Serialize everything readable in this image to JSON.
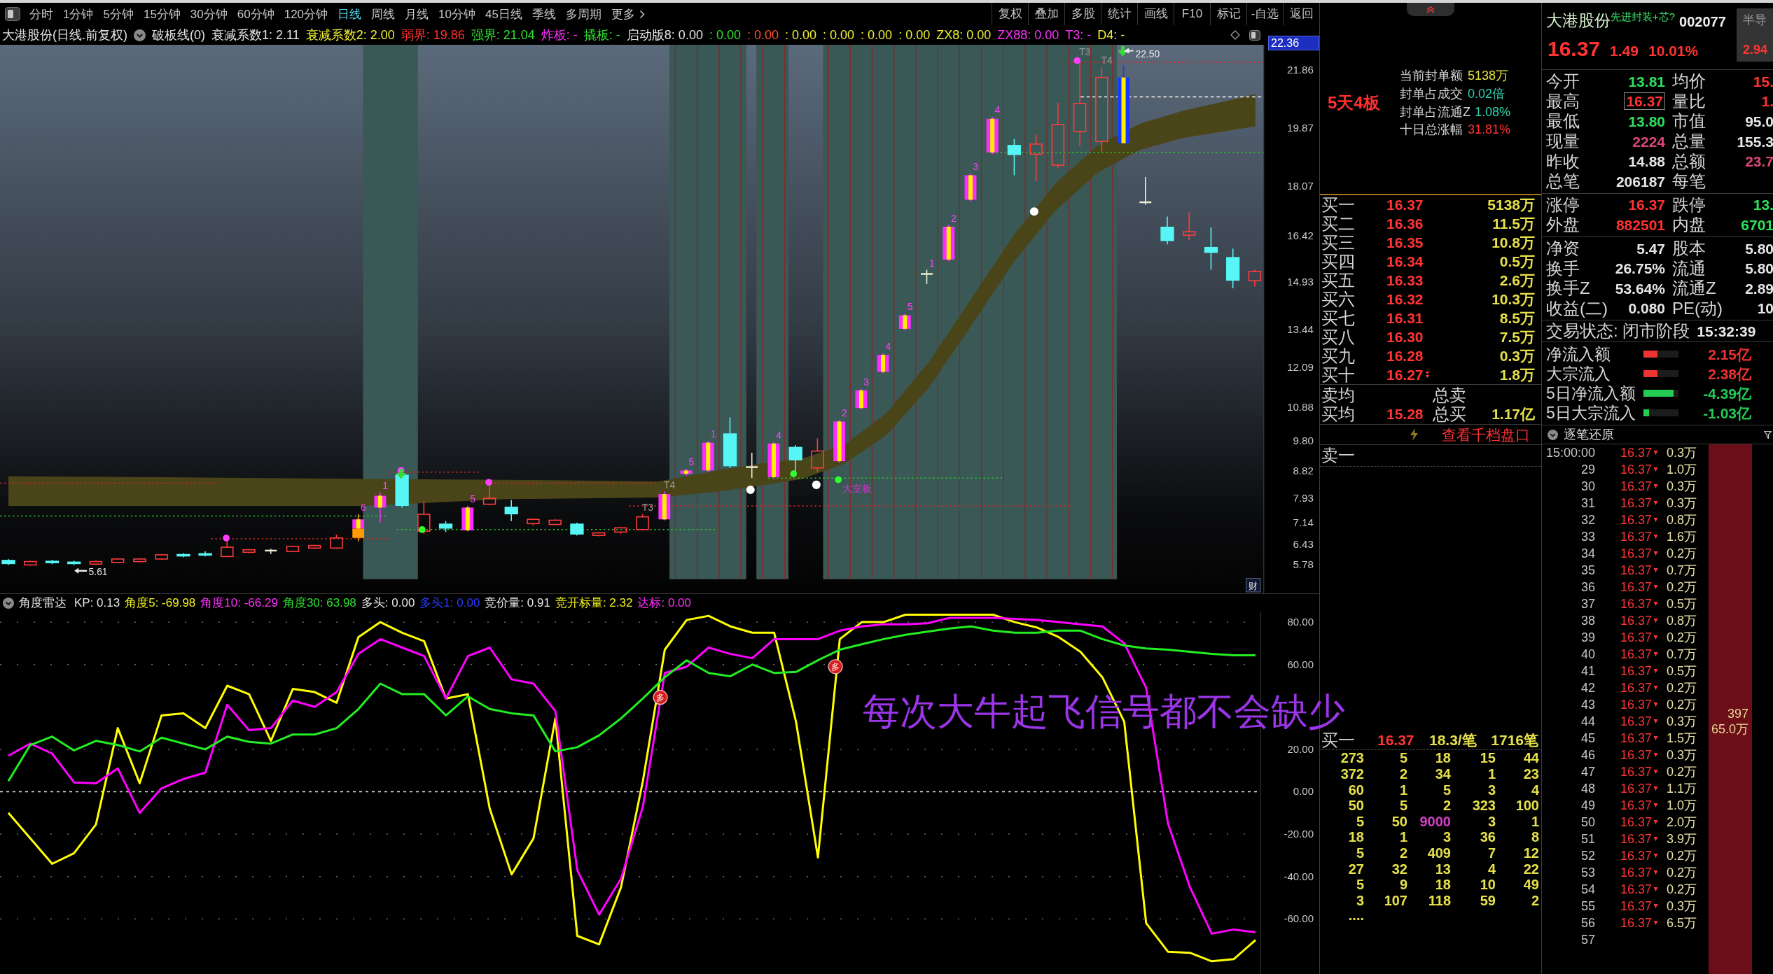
{
  "toolbar": {
    "periods": [
      {
        "label": "分时",
        "selected": false,
        "kind": "tab"
      },
      {
        "label": "1分钟",
        "selected": false,
        "kind": "tab"
      },
      {
        "label": "5分钟",
        "selected": false,
        "kind": "tab"
      },
      {
        "label": "15分钟",
        "selected": false,
        "kind": "tab"
      },
      {
        "label": "30分钟",
        "selected": false,
        "kind": "tab"
      },
      {
        "label": "60分钟",
        "selected": false,
        "kind": "tab"
      },
      {
        "label": "120分钟",
        "selected": false,
        "kind": "tab"
      },
      {
        "label": "日线",
        "selected": true,
        "kind": "tab"
      },
      {
        "label": "周线",
        "selected": false,
        "kind": "tab"
      },
      {
        "label": "月线",
        "selected": false,
        "kind": "tab"
      },
      {
        "label": "10分钟",
        "selected": false,
        "kind": "tab"
      },
      {
        "label": "45日线",
        "selected": false,
        "kind": "tab"
      },
      {
        "label": "季线",
        "selected": false,
        "kind": "tab"
      },
      {
        "label": "多周期",
        "selected": false,
        "kind": "tab"
      },
      {
        "label": "更多",
        "selected": false,
        "kind": "menu"
      }
    ],
    "actions": [
      "复权",
      "叠加",
      "多股",
      "统计",
      "画线",
      "F10",
      "标记",
      "-自选",
      "返回"
    ]
  },
  "chart_header": {
    "title": "大港股份(日线.前复权)",
    "indicator": "破板线(0)",
    "values": [
      {
        "text": "衰减系数1: 2.11",
        "color": "#e6e6e6"
      },
      {
        "text": "衰减系数2: 2.00",
        "color": "#f0f030"
      },
      {
        "text": "弱界: 19.86",
        "color": "#ff3030"
      },
      {
        "text": "强界: 21.04",
        "color": "#30e030"
      },
      {
        "text": "炸板: -",
        "color": "#ff30ff"
      },
      {
        "text": "撬板: -",
        "color": "#30e030"
      },
      {
        "text": "启动版8: 0.00",
        "color": "#e6e6e6"
      },
      {
        "text": ": 0.00",
        "color": "#30e030"
      },
      {
        "text": ": 0.00",
        "color": "#ff5030"
      },
      {
        "text": ": 0.00",
        "color": "#f0f030"
      },
      {
        "text": ": 0.00",
        "color": "#f0f030"
      },
      {
        "text": ": 0.00",
        "color": "#f0f030"
      },
      {
        "text": ": 0.00",
        "color": "#f0f030"
      },
      {
        "text": "ZX8: 0.00",
        "color": "#f0f030"
      },
      {
        "text": "ZX88: 0.00",
        "color": "#ff30ff"
      },
      {
        "text": "T3: -",
        "color": "#ff30ff"
      },
      {
        "text": "D4: -",
        "color": "#f0f030"
      }
    ]
  },
  "price_chart": {
    "current_price": "22.36",
    "axis_labels": [
      "21.86",
      "19.87",
      "18.07",
      "16.42",
      "14.93",
      "13.44",
      "12.09",
      "10.88",
      "9.80",
      "8.82",
      "7.93",
      "7.14",
      "6.43",
      "5.78"
    ],
    "marks": [
      {
        "label": "6",
        "color": "#ff40ff"
      },
      {
        "label": "1",
        "color": "#ff40ff"
      },
      {
        "label": "5",
        "color": "#ff40ff"
      },
      {
        "label": "T3",
        "color": "#9a9a9a"
      },
      {
        "label": "T4",
        "color": "#9a9a9a"
      },
      {
        "label": "5",
        "color": "#ff40ff"
      },
      {
        "label": "1",
        "color": "#ff40ff"
      },
      {
        "label": "4",
        "color": "#ff40ff"
      },
      {
        "label": "2",
        "color": "#ff40ff"
      },
      {
        "label": "3",
        "color": "#ff40ff"
      },
      {
        "label": "4",
        "color": "#ff40ff"
      },
      {
        "label": "5",
        "color": "#ff40ff"
      },
      {
        "label": "1",
        "color": "#ff40ff"
      },
      {
        "label": "2",
        "color": "#ff40ff"
      },
      {
        "label": "3",
        "color": "#ff40ff"
      },
      {
        "label": "4",
        "color": "#ff40ff"
      },
      {
        "label": "T3",
        "color": "#9a9a9a"
      },
      {
        "label": "T4",
        "color": "#9a9a9a"
      }
    ],
    "note": "大室板",
    "high_label": "22.50",
    "low_label": "5.61",
    "corner_tag": "财"
  },
  "indicator_panel": {
    "title": "角度雷达",
    "values": [
      {
        "text": "KP: 0.13",
        "color": "#e6e6e6"
      },
      {
        "text": "角度5: -69.98",
        "color": "#f0f020"
      },
      {
        "text": "角度10: -66.29",
        "color": "#ff30ff"
      },
      {
        "text": "角度30: 63.98",
        "color": "#30e030"
      },
      {
        "text": "多头: 0.00",
        "color": "#e6e6e6"
      },
      {
        "text": "多头1: 0.00",
        "color": "#2a3cff"
      },
      {
        "text": "竞价量: 0.91",
        "color": "#e6e6e6"
      },
      {
        "text": "竞开标量: 2.32",
        "color": "#f0f020"
      },
      {
        "text": "达标: 0.00",
        "color": "#ff30ff"
      }
    ],
    "chart_data": {
      "type": "line",
      "categories": [
        null,
        null,
        null,
        null,
        null,
        null,
        null,
        null,
        null,
        null,
        null,
        null,
        null,
        null,
        null,
        null,
        null,
        null,
        null,
        null,
        null,
        null,
        null,
        null,
        null,
        null,
        null,
        null,
        null,
        null,
        null,
        null,
        null,
        null,
        null,
        null,
        null,
        null,
        null,
        null,
        null,
        null,
        null,
        null,
        null,
        null,
        null,
        null,
        null,
        null,
        null,
        null,
        null,
        null,
        null,
        null,
        null,
        null
      ],
      "ylim": [
        -86,
        85
      ],
      "yticks": [
        {
          "value": 80,
          "label": "80.00"
        },
        {
          "value": 60,
          "label": "60.00"
        },
        {
          "value": 20,
          "label": "20.00"
        },
        {
          "value": 0,
          "label": "0.00"
        },
        {
          "value": -20,
          "label": "-20.00"
        },
        {
          "value": -40,
          "label": "-40.00"
        },
        {
          "value": -60,
          "label": "-60.00"
        }
      ],
      "grid": true,
      "ref_lines": [
        {
          "axis": "y",
          "value": 0,
          "color": "#e8e8e8"
        }
      ],
      "series": [
        {
          "color": "#ffff00",
          "values": [
            -10,
            -22,
            -34,
            -29,
            -15.5,
            30,
            4,
            36,
            37,
            30,
            50,
            46,
            24,
            48.5,
            47,
            42,
            73,
            80,
            75,
            71,
            44,
            46,
            -8,
            -39,
            -22,
            34.6,
            -68,
            -72,
            -45,
            5,
            67,
            81,
            83,
            78,
            75,
            75,
            33,
            -31,
            72,
            80,
            80,
            83.5,
            83.5,
            83.5,
            83.5,
            83.5,
            80,
            77.5,
            73,
            66,
            54,
            33,
            -62,
            -75.5,
            -76,
            -80,
            -79,
            -70
          ]
        },
        {
          "color": "#ff00ff",
          "values": [
            17,
            22.7,
            18,
            4.4,
            4,
            11,
            -10,
            1.6,
            6,
            9,
            41,
            29,
            30,
            43,
            40,
            47,
            65,
            72,
            68,
            64,
            44,
            64,
            68,
            53,
            51,
            38,
            -37,
            -58,
            -41,
            -7,
            56,
            59,
            68,
            65,
            63,
            72,
            72,
            72,
            76,
            78,
            79,
            79,
            79.5,
            82,
            82,
            82,
            81.5,
            81,
            80,
            79,
            78,
            70,
            49,
            -15,
            -45,
            -67,
            -65,
            -66.3
          ]
        },
        {
          "color": "#22ee22",
          "values": [
            5,
            22,
            26,
            19.5,
            24,
            22,
            19,
            25.5,
            22.7,
            20,
            26,
            23.5,
            22.7,
            27,
            27,
            30,
            39,
            51,
            46,
            46,
            36,
            45,
            39,
            37,
            36,
            19,
            21,
            26.6,
            34.6,
            44,
            54,
            62,
            56,
            54.5,
            60,
            56,
            56.5,
            62,
            67,
            69.6,
            72,
            74,
            75.5,
            77,
            78,
            76,
            75,
            75,
            76,
            76,
            72,
            69,
            67.6,
            67,
            66,
            65,
            64.4,
            64.4
          ]
        }
      ]
    },
    "signals": [
      {
        "label": "多"
      },
      {
        "label": "多"
      }
    ],
    "overlay_text": "每次大牛起飞信号都不会缺少"
  },
  "order_book": {
    "limit_summary": {
      "streak": "5天4板",
      "rows": [
        {
          "label": "当前封单额",
          "value": "5138万",
          "color": "#e6e040"
        },
        {
          "label": "封单占成交",
          "value": "0.02倍",
          "color": "#2ed2b0"
        },
        {
          "label": "封单占流通Z",
          "value": "1.08%",
          "color": "#2ed2b0"
        },
        {
          "label": "十日总涨幅",
          "value": "31.81%",
          "color": "#ff3333"
        }
      ]
    },
    "bids": [
      {
        "label": "买一",
        "price": "16.37",
        "volume": "5138万",
        "flag": false
      },
      {
        "label": "买二",
        "price": "16.36",
        "volume": "11.5万",
        "flag": false
      },
      {
        "label": "买三",
        "price": "16.35",
        "volume": "10.8万",
        "flag": false
      },
      {
        "label": "买四",
        "price": "16.34",
        "volume": "0.5万",
        "flag": false
      },
      {
        "label": "买五",
        "price": "16.33",
        "volume": "2.6万",
        "flag": false
      },
      {
        "label": "买六",
        "price": "16.32",
        "volume": "10.3万",
        "flag": false
      },
      {
        "label": "买七",
        "price": "16.31",
        "volume": "8.5万",
        "flag": false
      },
      {
        "label": "买八",
        "price": "16.30",
        "volume": "7.5万",
        "flag": false
      },
      {
        "label": "买九",
        "price": "16.28",
        "volume": "0.3万",
        "flag": false
      },
      {
        "label": "买十",
        "price": "16.27",
        "volume": "1.8万",
        "flag": true
      }
    ],
    "averages": [
      {
        "label": "卖均",
        "total_label": "总卖"
      },
      {
        "label": "买均",
        "price": "15.28",
        "total_label": "总买",
        "total": "1.17亿"
      }
    ],
    "depth_link": "查看千档盘口",
    "ask_queue": {
      "label": "卖一"
    },
    "bid_queue": {
      "label": "买一",
      "price": "16.37",
      "per_order": "18.3/笔",
      "orders": "1716笔",
      "rows": [
        {
          "cells": [
            {
              "text": "273",
              "large": false
            },
            {
              "text": "5",
              "large": false
            },
            {
              "text": "18",
              "large": false
            },
            {
              "text": "15",
              "large": false
            },
            {
              "text": "44",
              "large": false
            }
          ]
        },
        {
          "cells": [
            {
              "text": "372",
              "large": false
            },
            {
              "text": "2",
              "large": false
            },
            {
              "text": "34",
              "large": false
            },
            {
              "text": "1",
              "large": false
            },
            {
              "text": "23",
              "large": false
            }
          ]
        },
        {
          "cells": [
            {
              "text": "60",
              "large": false
            },
            {
              "text": "1",
              "large": false
            },
            {
              "text": "5",
              "large": false
            },
            {
              "text": "3",
              "large": false
            },
            {
              "text": "4",
              "large": false
            }
          ]
        },
        {
          "cells": [
            {
              "text": "50",
              "large": false
            },
            {
              "text": "5",
              "large": false
            },
            {
              "text": "2",
              "large": false
            },
            {
              "text": "323",
              "large": false
            },
            {
              "text": "100",
              "large": false
            }
          ]
        },
        {
          "cells": [
            {
              "text": "5",
              "large": false
            },
            {
              "text": "50",
              "large": false
            },
            {
              "text": "9000",
              "large": true
            },
            {
              "text": "3",
              "large": false
            },
            {
              "text": "1",
              "large": false
            }
          ]
        },
        {
          "cells": [
            {
              "text": "18",
              "large": false
            },
            {
              "text": "1",
              "large": false
            },
            {
              "text": "3",
              "large": false
            },
            {
              "text": "36",
              "large": false
            },
            {
              "text": "8",
              "large": false
            }
          ]
        },
        {
          "cells": [
            {
              "text": "5",
              "large": false
            },
            {
              "text": "2",
              "large": false
            },
            {
              "text": "409",
              "large": false
            },
            {
              "text": "7",
              "large": false
            },
            {
              "text": "12",
              "large": false
            }
          ]
        },
        {
          "cells": [
            {
              "text": "27",
              "large": false
            },
            {
              "text": "32",
              "large": false
            },
            {
              "text": "13",
              "large": false
            },
            {
              "text": "4",
              "large": false
            },
            {
              "text": "22",
              "large": false
            }
          ]
        },
        {
          "cells": [
            {
              "text": "5",
              "large": false
            },
            {
              "text": "9",
              "large": false
            },
            {
              "text": "18",
              "large": false
            },
            {
              "text": "10",
              "large": false
            },
            {
              "text": "49",
              "large": false
            }
          ]
        },
        {
          "cells": [
            {
              "text": "3",
              "large": false
            },
            {
              "text": "107",
              "large": false
            },
            {
              "text": "118",
              "large": false
            },
            {
              "text": "59",
              "large": false
            },
            {
              "text": "2",
              "large": false
            }
          ]
        }
      ],
      "more": "...."
    }
  },
  "quote": {
    "name": "大港股份",
    "concept": "先进封装+芯?",
    "code": "002077",
    "sector": "半导",
    "sector_change": "2.94",
    "price": "16.37",
    "change": "1.49",
    "change_pct": "10.01%",
    "stat_groups": [
      [
        {
          "cells": [
            {
              "label": "今开",
              "value": "13.81",
              "color": "#2ee05e",
              "highlighted": false
            },
            {
              "label": "均价",
              "value": "15.",
              "color": "#ff3333",
              "highlighted": false
            }
          ]
        },
        {
          "cells": [
            {
              "label": "最高",
              "value": "16.37",
              "color": "#ff3333",
              "highlighted": true
            },
            {
              "label": "量比",
              "value": "1.",
              "color": "#ff3333",
              "highlighted": false
            }
          ]
        },
        {
          "cells": [
            {
              "label": "最低",
              "value": "13.80",
              "color": "#2ee05e",
              "highlighted": false
            },
            {
              "label": "市值",
              "value": "95.0",
              "color": "#e6e6e6",
              "highlighted": false
            }
          ]
        },
        {
          "cells": [
            {
              "label": "现量",
              "value": "2224",
              "color": "#d84874",
              "highlighted": false
            },
            {
              "label": "总量",
              "value": "155.3",
              "color": "#e6e6e6",
              "highlighted": false
            }
          ]
        },
        {
          "cells": [
            {
              "label": "昨收",
              "value": "14.88",
              "color": "#e6e6e6",
              "highlighted": false
            },
            {
              "label": "总额",
              "value": "23.7",
              "color": "#d84874",
              "highlighted": false
            }
          ]
        },
        {
          "cells": [
            {
              "label": "总笔",
              "value": "206187",
              "color": "#e6e6e6",
              "highlighted": false
            },
            {
              "label": "每笔"
            }
          ]
        }
      ],
      [
        {
          "cells": [
            {
              "label": "涨停",
              "value": "16.37",
              "color": "#ff3333",
              "highlighted": false
            },
            {
              "label": "跌停",
              "value": "13.",
              "color": "#2ee05e",
              "highlighted": false
            }
          ]
        },
        {
          "cells": [
            {
              "label": "外盘",
              "value": "882501",
              "color": "#ff3333",
              "highlighted": false
            },
            {
              "label": "内盘",
              "value": "6701",
              "color": "#2ee05e",
              "highlighted": false
            }
          ]
        }
      ],
      [
        {
          "cells": [
            {
              "label": "净资",
              "value": "5.47",
              "color": "#e6e6e6",
              "highlighted": false
            },
            {
              "label": "股本",
              "value": "5.80",
              "color": "#e6e6e6",
              "highlighted": false
            }
          ]
        },
        {
          "cells": [
            {
              "label": "换手",
              "value": "26.75%",
              "color": "#e6e6e6",
              "highlighted": false
            },
            {
              "label": "流通",
              "value": "5.80",
              "color": "#e6e6e6",
              "highlighted": false
            }
          ]
        },
        {
          "cells": [
            {
              "label": "换手Z",
              "value": "53.64%",
              "color": "#e6e6e6",
              "highlighted": false
            },
            {
              "label": "流通Z",
              "value": "2.89",
              "color": "#e6e6e6",
              "highlighted": false
            }
          ]
        },
        {
          "cells": [
            {
              "label": "收益(二)",
              "value": "0.080",
              "color": "#e6e6e6",
              "highlighted": false
            },
            {
              "label": "PE(动)",
              "value": "10",
              "color": "#e6e6e6",
              "highlighted": false
            }
          ]
        }
      ]
    ],
    "status": {
      "text": "交易状态: 闭市阶段",
      "time": "15:32:39"
    },
    "flows": [
      {
        "label": "净流入额",
        "level": 0.4,
        "color": "#ee3333",
        "value": "2.15亿"
      },
      {
        "label": "大宗流入",
        "level": 0.4,
        "color": "#ee3333",
        "value": "2.38亿"
      },
      {
        "label": "5日净流入额",
        "level": 0.86,
        "color": "#22cc55",
        "value": "-4.39亿"
      },
      {
        "label": "5日大宗流入",
        "level": 0.16,
        "color": "#22cc55",
        "value": "-1.03亿"
      }
    ]
  },
  "tick_list": {
    "title": "逐笔还原",
    "rows": [
      {
        "time": "15:00:00",
        "price": "16.37",
        "volume": "0.3万"
      },
      {
        "time": "29",
        "price": "16.37",
        "volume": "1.0万"
      },
      {
        "time": "30",
        "price": "16.37",
        "volume": "0.3万"
      },
      {
        "time": "31",
        "price": "16.37",
        "volume": "0.3万"
      },
      {
        "time": "32",
        "price": "16.37",
        "volume": "0.8万"
      },
      {
        "time": "33",
        "price": "16.37",
        "volume": "1.6万"
      },
      {
        "time": "34",
        "price": "16.37",
        "volume": "0.2万"
      },
      {
        "time": "35",
        "price": "16.37",
        "volume": "0.7万"
      },
      {
        "time": "36",
        "price": "16.37",
        "volume": "0.2万"
      },
      {
        "time": "37",
        "price": "16.37",
        "volume": "0.5万"
      },
      {
        "time": "38",
        "price": "16.37",
        "volume": "0.8万"
      },
      {
        "time": "39",
        "price": "16.37",
        "volume": "0.2万"
      },
      {
        "time": "40",
        "price": "16.37",
        "volume": "0.7万"
      },
      {
        "time": "41",
        "price": "16.37",
        "volume": "0.5万"
      },
      {
        "time": "42",
        "price": "16.37",
        "volume": "0.2万"
      },
      {
        "time": "43",
        "price": "16.37",
        "volume": "0.2万"
      },
      {
        "time": "44",
        "price": "16.37",
        "volume": "0.3万"
      },
      {
        "time": "45",
        "price": "16.37",
        "volume": "1.5万"
      },
      {
        "time": "46",
        "price": "16.37",
        "volume": "0.3万"
      },
      {
        "time": "47",
        "price": "16.37",
        "volume": "0.2万"
      },
      {
        "time": "48",
        "price": "16.37",
        "volume": "1.1万"
      },
      {
        "time": "49",
        "price": "16.37",
        "volume": "1.0万"
      },
      {
        "time": "50",
        "price": "16.37",
        "volume": "2.0万"
      },
      {
        "time": "51",
        "price": "16.37",
        "volume": "3.9万"
      },
      {
        "time": "52",
        "price": "16.37",
        "volume": "0.2万"
      },
      {
        "time": "53",
        "price": "16.37",
        "volume": "0.2万"
      },
      {
        "time": "54",
        "price": "16.37",
        "volume": "0.2万"
      },
      {
        "time": "55",
        "price": "16.37",
        "volume": "0.3万"
      },
      {
        "time": "56",
        "price": "16.37",
        "volume": "6.5万"
      },
      {
        "time": "57"
      }
    ],
    "bar_count": "397",
    "bar_volume": "65.0万"
  }
}
